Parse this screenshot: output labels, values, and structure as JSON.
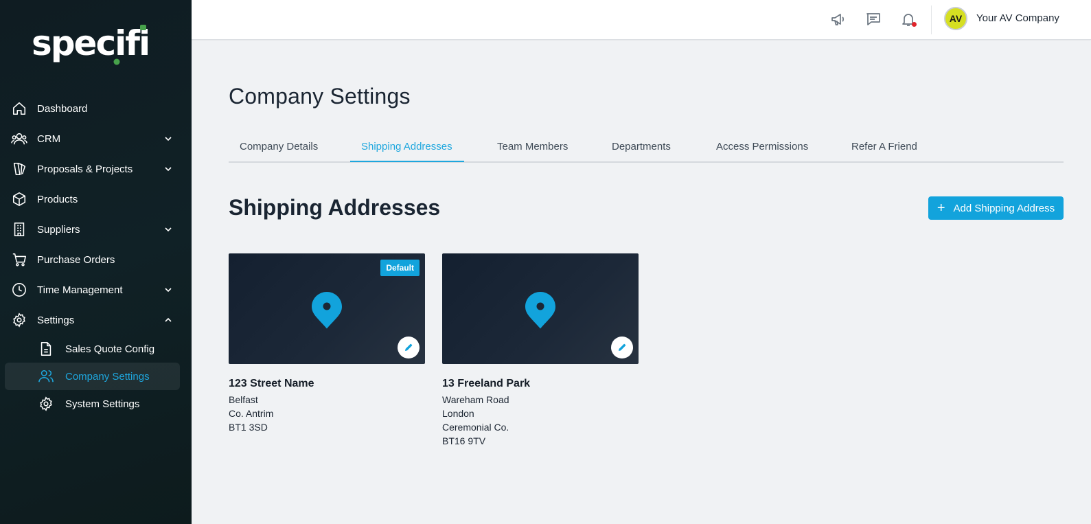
{
  "brand": {
    "logo_text": "specifi",
    "accent": "#12a3dc",
    "logo_green": "#47a24b"
  },
  "sidebar": {
    "items": [
      {
        "label": "Dashboard",
        "icon": "home-icon"
      },
      {
        "label": "CRM",
        "icon": "users-icon",
        "expandable": true
      },
      {
        "label": "Proposals & Projects",
        "icon": "proposals-icon",
        "expandable": true
      },
      {
        "label": "Products",
        "icon": "box-icon"
      },
      {
        "label": "Suppliers",
        "icon": "building-icon",
        "expandable": true
      },
      {
        "label": "Purchase Orders",
        "icon": "cart-icon"
      },
      {
        "label": "Time Management",
        "icon": "clock-icon",
        "expandable": true
      },
      {
        "label": "Settings",
        "icon": "gear-icon",
        "expanded": true
      }
    ],
    "sub_items": [
      {
        "label": "Sales Quote Config",
        "icon": "document-icon"
      },
      {
        "label": "Company Settings",
        "icon": "users-icon",
        "active": true
      },
      {
        "label": "System Settings",
        "icon": "gear-icon"
      }
    ]
  },
  "topbar": {
    "avatar_initials": "AV",
    "company_name": "Your AV Company",
    "icons": [
      "megaphone-icon",
      "chat-icon",
      "bell-icon"
    ]
  },
  "main": {
    "page_title": "Company Settings",
    "tabs": [
      {
        "label": "Company Details"
      },
      {
        "label": "Shipping Addresses",
        "active": true
      },
      {
        "label": "Team Members"
      },
      {
        "label": "Departments"
      },
      {
        "label": "Access Permissions"
      },
      {
        "label": "Refer A Friend"
      }
    ],
    "section_title": "Shipping Addresses",
    "add_button_label": "Add Shipping Address",
    "addresses": [
      {
        "line1": "123 Street Name",
        "lines": [
          "Belfast",
          "Co. Antrim",
          "BT1 3SD"
        ],
        "default": true,
        "badge": "Default"
      },
      {
        "line1": "13 Freeland Park",
        "lines": [
          "Wareham Road",
          "London",
          "Ceremonial Co.",
          "BT16 9TV"
        ],
        "default": false
      }
    ]
  }
}
